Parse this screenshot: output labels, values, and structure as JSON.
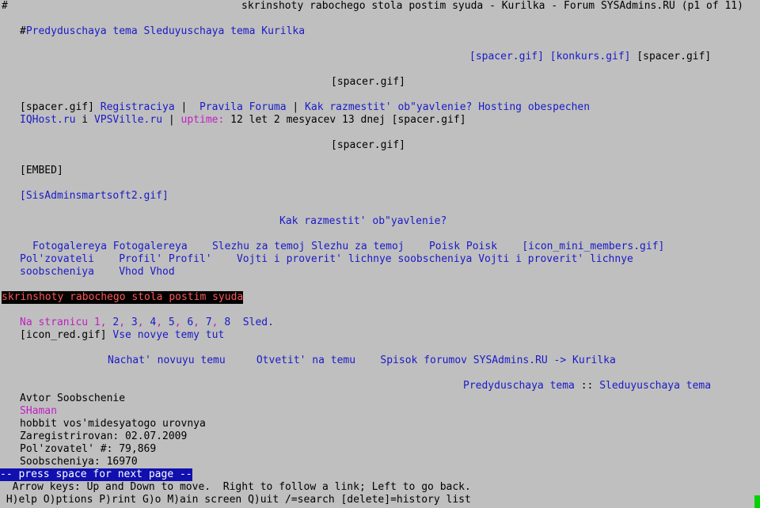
{
  "header": {
    "hash": "#",
    "title": "skrinshoty rabochego stola postim syuda - Kurilka - Forum SYSAdmins.RU (p1 of 11)"
  },
  "nav_top": {
    "hash": "#",
    "prev": "Predyduschaya tema",
    "next": "Sleduyuschaya tema",
    "kurilka": "Kurilka"
  },
  "banners": {
    "spacer1": "[spacer.gif]",
    "konkurs": "[konkurs.gif]",
    "spacer2": "[spacer.gif]",
    "spacer3": "[spacer.gif]"
  },
  "links_row1": {
    "spacer": "[spacer.gif]",
    "registraciya": "Registraciya",
    "sep1": " | ",
    "pravila": "Pravila Foruma",
    "sep2": " | ",
    "kak": "Kak razmestit' ob\"yavlenie?",
    "hosting": "Hosting obespechen"
  },
  "links_row2": {
    "iqhost": "IQHost.ru",
    "i": " i ",
    "vpsville": "VPSVille.ru",
    "sep": " | ",
    "uptime_label": "uptime:",
    "uptime_value": " 12 let 2 mesyacev 13 dnej ",
    "spacer": "[spacer.gif]"
  },
  "spacer_center": "[spacer.gif]",
  "embed": "[EMBED]",
  "sisadmin_img": "[SisAdminsmartsoft2.gif]",
  "kak_center": "Kak razmestit' ob\"yavlenie?",
  "menu": {
    "fotogalereya": "Fotogalereya Fotogalereya",
    "slezhu": "Slezhu za temoj Slezhu za temoj",
    "poisk": "Poisk Poisk",
    "icon_members": "[icon_mini_members.gif]",
    "polzovateli": "Pol'zovateli",
    "profil": "Profil' Profil'",
    "vojti_a": "Vojti i proverit' lichnye soobscheniya Vojti i proverit' lichnye",
    "vojti_b": "soobscheniya",
    "vhod": "Vhod Vhod"
  },
  "topic_title": "skrinshoty rabochego stola postim syuda",
  "pages": {
    "label": "Na stranicu",
    "items": [
      "1",
      "2",
      "3",
      "4",
      "5",
      "6",
      "7",
      "8"
    ],
    "next": "Sled."
  },
  "icon_red": "[icon_red.gif]",
  "vse_novye": "Vse novye temy tut",
  "actions": {
    "new_topic": "Nachat' novuyu temu",
    "reply": "Otvetit' na temu",
    "forum_list": "Spisok forumov SYSAdmins.RU",
    "arrow": " -> ",
    "kurilka": "Kurilka"
  },
  "topic_nav": {
    "prev": "Predyduschaya tema",
    "sep": " :: ",
    "next": "Sleduyuschaya tema"
  },
  "post": {
    "header": "Avtor Soobschenie",
    "author": "SHaman",
    "rank": "hobbit vos'midesyatogo urovnya",
    "registered": "Zaregistrirovan: 02.07.2009",
    "user_no": "Pol'zovatel' #: 79,869",
    "messages": "Soobscheniya: 16970"
  },
  "status": {
    "press_space": "-- press space for next page --",
    "help1": "  Arrow keys: Up and Down to move.  Right to follow a link; Left to go back.",
    "help2": " H)elp O)ptions P)rint G)o M)ain screen Q)uit /=search [delete]=history list"
  }
}
